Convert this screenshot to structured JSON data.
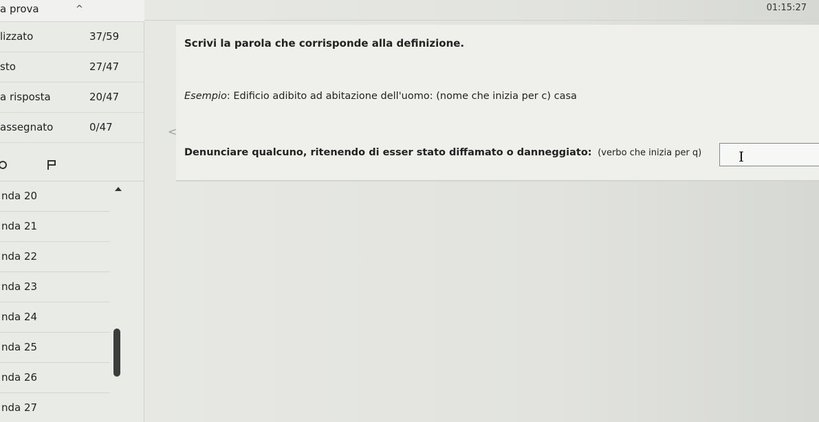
{
  "sidebar": {
    "title": "a prova",
    "chevron": "^",
    "stats": [
      {
        "label": "lizzato",
        "value": "37/59"
      },
      {
        "label": "sto",
        "value": "27/47"
      },
      {
        "label": "a risposta",
        "value": "20/47"
      },
      {
        "label": "assegnato",
        "value": "0/47"
      }
    ],
    "questions": [
      "nda 20",
      "nda 21",
      "nda 22",
      "nda 23",
      "nda 24",
      "nda 25",
      "nda 26",
      "nda 27"
    ]
  },
  "header": {
    "timer": "01:15:27"
  },
  "question": {
    "instruction": "Scrivi la parola che corrisponde alla definizione.",
    "example_label": "Esempio",
    "example_text": ": Edificio adibito ad abitazione dell'uomo: (nome che inizia per c) casa",
    "prompt": "Denunciare qualcuno, ritenendo di esser stato diffamato o danneggiato:",
    "hint": "(verbo che inizia per q)",
    "answer_value": ""
  }
}
